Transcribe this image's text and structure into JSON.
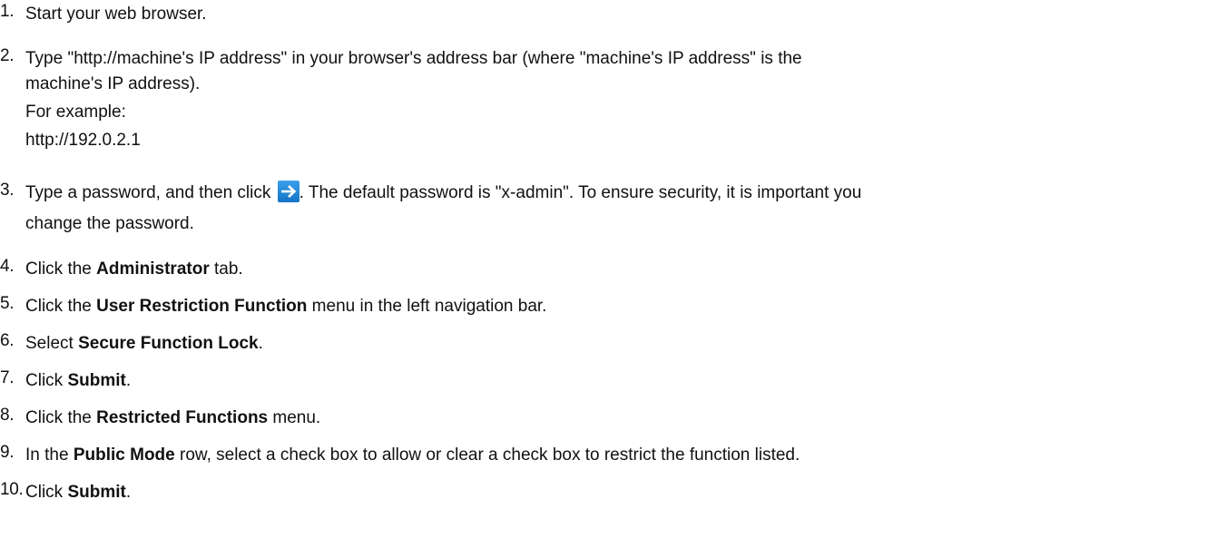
{
  "steps": [
    {
      "num": "1.",
      "text": "Start your web browser."
    },
    {
      "num": "2.",
      "line1": "Type \"http://machine's IP address\" in your browser's address bar (where \"machine's IP address\" is the",
      "line2": "machine's IP address).",
      "example_label": "For example:",
      "example_url": "http://192.0.2.1"
    },
    {
      "num": "3.",
      "before_icon": "Type a password, and then click ",
      "icon": "arrow-right-icon",
      "after_icon": ". The default password is \"x-admin\". To ensure security, it is important you",
      "line2": "change the password."
    },
    {
      "num": "4.",
      "pre": "Click the ",
      "bold": "Administrator",
      "post": " tab."
    },
    {
      "num": "5.",
      "pre": "Click the ",
      "bold": "User Restriction Function",
      "post": " menu in the left navigation bar."
    },
    {
      "num": "6.",
      "pre": "Select ",
      "bold": "Secure Function Lock",
      "post": "."
    },
    {
      "num": "7.",
      "pre": "Click ",
      "bold": "Submit",
      "post": "."
    },
    {
      "num": "8.",
      "pre": "Click the ",
      "bold": "Restricted Functions",
      "post": " menu."
    },
    {
      "num": "9.",
      "pre": "In the ",
      "bold": "Public Mode",
      "post": " row, select a check box to allow or clear a check box to restrict the function listed."
    },
    {
      "num": "10.",
      "pre": "Click ",
      "bold": "Submit",
      "post": "."
    }
  ],
  "colors": {
    "text": "#111111",
    "icon_bg": "#1f86d6",
    "icon_arrow": "#ffffff"
  }
}
